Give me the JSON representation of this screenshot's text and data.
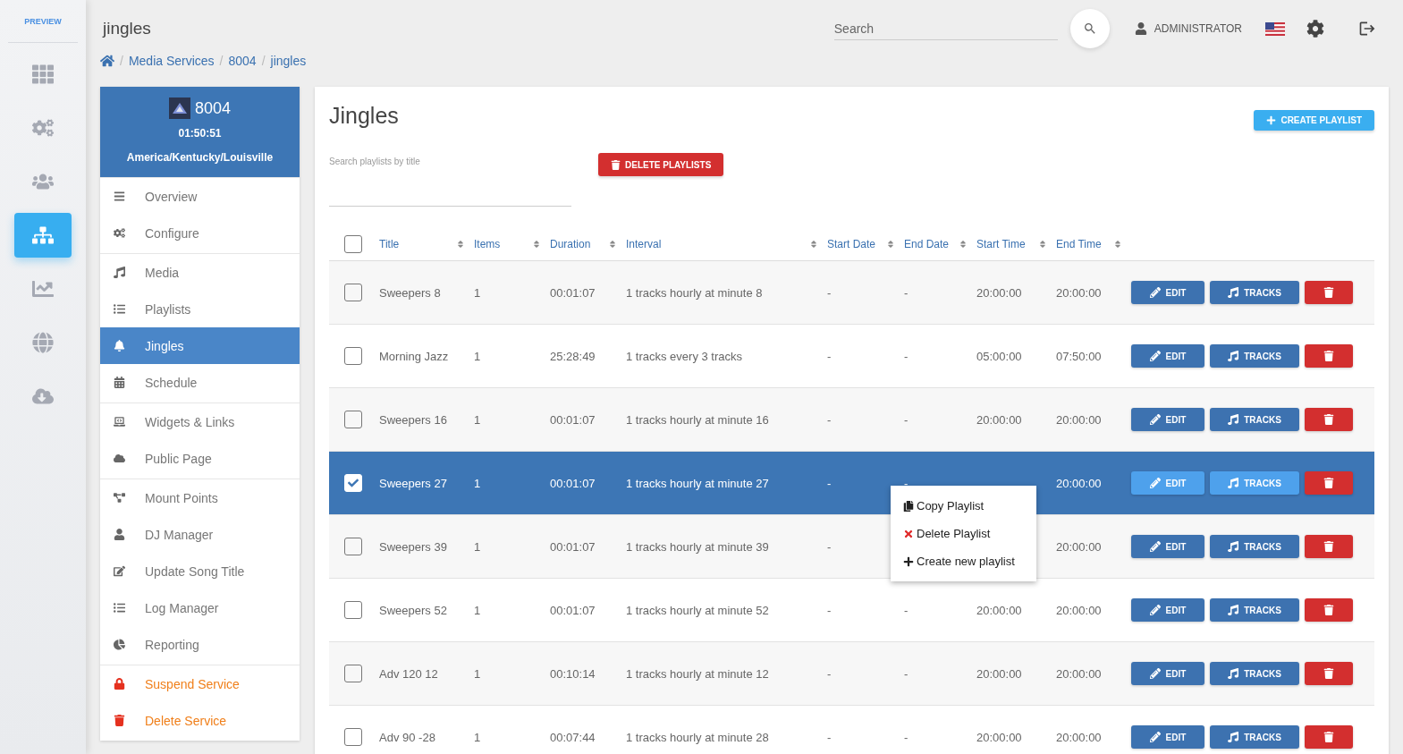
{
  "rail": {
    "badge": "PREVIEW",
    "items": [
      {
        "selected": false
      },
      {
        "selected": false
      },
      {
        "selected": false
      },
      {
        "selected": true
      },
      {
        "selected": false
      },
      {
        "selected": false
      },
      {
        "selected": false
      }
    ]
  },
  "header": {
    "title": "jingles",
    "search": {
      "placeholder": "Search"
    },
    "user": "ADMINISTRATOR"
  },
  "breadcrumb": [
    {
      "separator": "/",
      "label": "Media Services"
    },
    {
      "separator": "/",
      "label": "8004"
    },
    {
      "separator": "/",
      "label": "jingles"
    }
  ],
  "service": {
    "name": "8004",
    "clock": "01:50:51",
    "timezone": "America/Kentucky/Louisville",
    "menu_groups": [
      {
        "items": [
          {
            "label": "Overview",
            "selected": false,
            "kind": "normal"
          },
          {
            "label": "Configure",
            "selected": false,
            "kind": "normal"
          }
        ]
      },
      {
        "items": [
          {
            "label": "Media",
            "selected": false,
            "kind": "normal"
          },
          {
            "label": "Playlists",
            "selected": false,
            "kind": "normal"
          },
          {
            "label": "Jingles",
            "selected": true,
            "kind": "normal"
          },
          {
            "label": "Schedule",
            "selected": false,
            "kind": "normal"
          }
        ]
      },
      {
        "items": [
          {
            "label": "Widgets & Links",
            "selected": false,
            "kind": "normal"
          },
          {
            "label": "Public Page",
            "selected": false,
            "kind": "normal"
          }
        ]
      },
      {
        "items": [
          {
            "label": "Mount Points",
            "selected": false,
            "kind": "normal"
          },
          {
            "label": "DJ Manager",
            "selected": false,
            "kind": "normal"
          },
          {
            "label": "Update Song Title",
            "selected": false,
            "kind": "normal"
          },
          {
            "label": "Log Manager",
            "selected": false,
            "kind": "normal"
          },
          {
            "label": "Reporting",
            "selected": false,
            "kind": "normal"
          }
        ]
      },
      {
        "items": [
          {
            "label": "Suspend Service",
            "selected": false,
            "kind": "danger"
          },
          {
            "label": "Delete Service",
            "selected": false,
            "kind": "danger"
          }
        ]
      }
    ]
  },
  "panel": {
    "title": "Jingles",
    "create_button": "CREATE PLAYLIST",
    "search": {
      "placeholder": "Search playlists by title"
    },
    "delete_button": "DELETE PLAYLISTS"
  },
  "table": {
    "columns": [
      "Title",
      "Items",
      "Duration",
      "Interval",
      "Start Date",
      "End Date",
      "Start Time",
      "End Time"
    ],
    "select_all": {
      "checked": false
    },
    "rows": [
      {
        "checked": false,
        "menu_open": false,
        "cells": [
          "Sweepers 8",
          "1",
          "00:01:07",
          "1 tracks hourly at minute 8",
          "-",
          "-",
          "20:00:00",
          "20:00:00"
        ],
        "actions": [
          "EDIT",
          "TRACKS"
        ]
      },
      {
        "checked": false,
        "menu_open": false,
        "cells": [
          "Morning Jazz",
          "1",
          "25:28:49",
          "1 tracks every 3 tracks",
          "-",
          "-",
          "05:00:00",
          "07:50:00"
        ],
        "actions": [
          "EDIT",
          "TRACKS"
        ]
      },
      {
        "checked": false,
        "menu_open": false,
        "cells": [
          "Sweepers 16",
          "1",
          "00:01:07",
          "1 tracks hourly at minute 16",
          "-",
          "-",
          "20:00:00",
          "20:00:00"
        ],
        "actions": [
          "EDIT",
          "TRACKS"
        ]
      },
      {
        "checked": true,
        "menu_open": true,
        "cells": [
          "Sweepers 27",
          "1",
          "00:01:07",
          "1 tracks hourly at minute 27",
          "-",
          "-",
          null,
          "20:00:00"
        ],
        "actions": [
          "EDIT",
          "TRACKS"
        ]
      },
      {
        "checked": false,
        "menu_open": false,
        "cells": [
          "Sweepers 39",
          "1",
          "00:01:07",
          "1 tracks hourly at minute 39",
          "-",
          null,
          null,
          "20:00:00"
        ],
        "actions": [
          "EDIT",
          "TRACKS"
        ]
      },
      {
        "checked": false,
        "menu_open": false,
        "cells": [
          "Sweepers 52",
          "1",
          "00:01:07",
          "1 tracks hourly at minute 52",
          "-",
          "-",
          "20:00:00",
          "20:00:00"
        ],
        "actions": [
          "EDIT",
          "TRACKS"
        ]
      },
      {
        "checked": false,
        "menu_open": false,
        "cells": [
          "Adv 120 12",
          "1",
          "00:10:14",
          "1 tracks hourly at minute 12",
          "-",
          "-",
          "20:00:00",
          "20:00:00"
        ],
        "actions": [
          "EDIT",
          "TRACKS"
        ]
      },
      {
        "checked": false,
        "menu_open": false,
        "cells": [
          "Adv 90 -28",
          "1",
          "00:07:44",
          "1 tracks hourly at minute 28",
          "-",
          "-",
          "20:00:00",
          "20:00:00"
        ],
        "actions": [
          "EDIT",
          "TRACKS"
        ]
      }
    ]
  },
  "context_menu": {
    "items": [
      {
        "label": "Copy Playlist",
        "kind": "copy"
      },
      {
        "label": "Delete Playlist",
        "kind": "delete"
      },
      {
        "label": "Create new playlist",
        "kind": "create"
      }
    ]
  }
}
